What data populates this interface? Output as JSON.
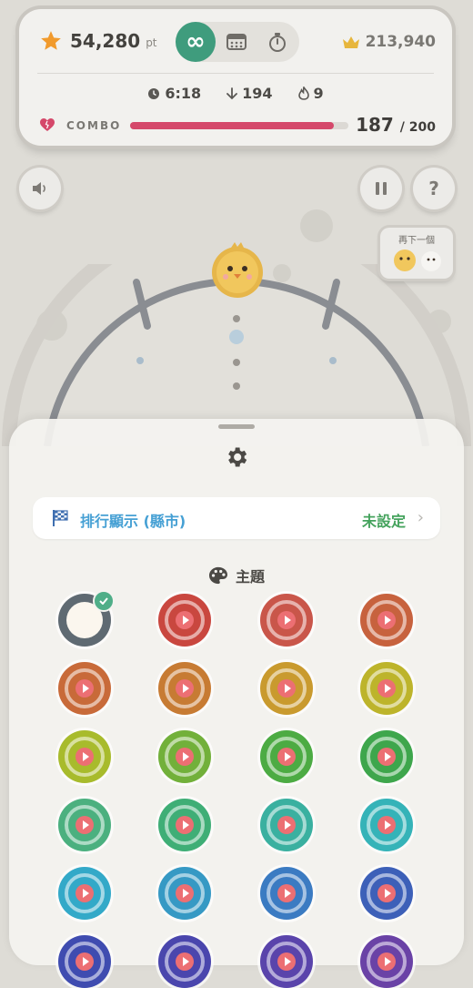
{
  "hud": {
    "score": "54,280",
    "score_unit": "pt",
    "best_score": "213,940",
    "time": "6:18",
    "drops": "194",
    "streak": "9",
    "combo_label": "COMBO",
    "combo_current": "187",
    "combo_max": "/ 200",
    "combo_fill_ratio": 0.935,
    "modes": [
      "infinite",
      "calendar",
      "timer"
    ],
    "active_mode": "infinite"
  },
  "next_preview": {
    "title": "再下一個"
  },
  "settings": {
    "ranking_label": "排行顯示 (縣市)",
    "ranking_value": "未設定",
    "theme_title": "主題",
    "themes": [
      {
        "color": "#5f6a72",
        "selected": true
      },
      {
        "color": "#c9473f"
      },
      {
        "color": "#c9564a"
      },
      {
        "color": "#c7623e"
      },
      {
        "color": "#c86a39"
      },
      {
        "color": "#c77b33"
      },
      {
        "color": "#c99a2e"
      },
      {
        "color": "#bdb42b"
      },
      {
        "color": "#a8bb2c"
      },
      {
        "color": "#72b03a"
      },
      {
        "color": "#4cab43"
      },
      {
        "color": "#3ea64c"
      },
      {
        "color": "#4bb07f"
      },
      {
        "color": "#3fae76"
      },
      {
        "color": "#3ab0a0"
      },
      {
        "color": "#35b3b8"
      },
      {
        "color": "#33a9c8"
      },
      {
        "color": "#3699c4"
      },
      {
        "color": "#3b7bc2"
      },
      {
        "color": "#3d60b8"
      },
      {
        "color": "#3f4cb0"
      },
      {
        "color": "#4a46ad"
      },
      {
        "color": "#5a44ab"
      },
      {
        "color": "#6a42a6"
      }
    ]
  },
  "colors": {
    "accent_green": "#3f9c7d",
    "combo_pink": "#d5486a",
    "rank_blue": "#46a0d4",
    "rank_value_green": "#45a35d"
  }
}
